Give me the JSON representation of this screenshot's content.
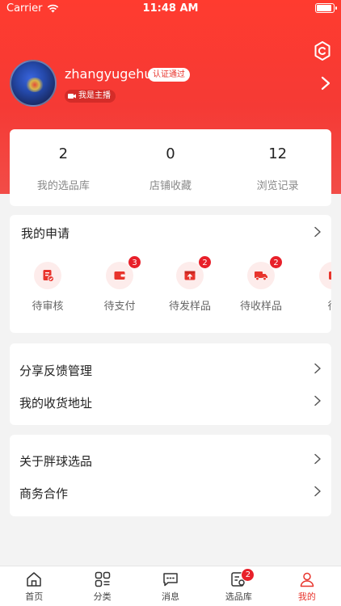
{
  "status_bar": {
    "carrier": "Carrier",
    "time": "11:48 AM"
  },
  "profile": {
    "username": "zhangyugehu",
    "verified_badge": "认证通过",
    "host_tag": "我是主播"
  },
  "stats": [
    {
      "value": "2",
      "label": "我的选品库"
    },
    {
      "value": "0",
      "label": "店铺收藏"
    },
    {
      "value": "12",
      "label": "浏览记录"
    }
  ],
  "applications": {
    "title": "我的申请",
    "items": [
      {
        "label": "待审核",
        "icon": "document-check-icon",
        "badge": ""
      },
      {
        "label": "待支付",
        "icon": "wallet-icon",
        "badge": "3"
      },
      {
        "label": "待发样品",
        "icon": "box-upload-icon",
        "badge": "2"
      },
      {
        "label": "待收样品",
        "icon": "truck-icon",
        "badge": "2"
      },
      {
        "label": "待",
        "icon": "partial-icon",
        "badge": ""
      }
    ]
  },
  "menu_group_1": [
    {
      "label": "分享反馈管理"
    },
    {
      "label": "我的收货地址"
    }
  ],
  "menu_group_2": [
    {
      "label": "关于胖球选品"
    },
    {
      "label": "商务合作"
    }
  ],
  "tabbar": [
    {
      "label": "首页",
      "icon": "home-icon",
      "badge": "",
      "active": false
    },
    {
      "label": "分类",
      "icon": "category-icon",
      "badge": "",
      "active": false
    },
    {
      "label": "消息",
      "icon": "message-icon",
      "badge": "",
      "active": false
    },
    {
      "label": "选品库",
      "icon": "product-library-icon",
      "badge": "2",
      "active": false
    },
    {
      "label": "我的",
      "icon": "profile-icon",
      "badge": "",
      "active": true
    }
  ],
  "colors": {
    "accent": "#e8342c",
    "hero": "#f53a35",
    "background": "#f3f3f3"
  }
}
